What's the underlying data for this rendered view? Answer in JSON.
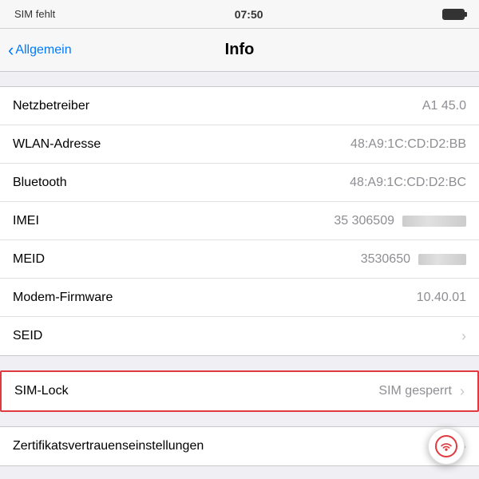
{
  "statusBar": {
    "carrier": "SIM fehlt",
    "time": "07:50"
  },
  "navBar": {
    "backLabel": "Allgemein",
    "title": "Info"
  },
  "sections": [
    {
      "id": "main-info",
      "rows": [
        {
          "label": "Netzbetreiber",
          "value": "A1 45.0",
          "hasChevron": false,
          "special": null
        },
        {
          "label": "WLAN-Adresse",
          "value": "48:A9:1C:CD:D2:BB",
          "hasChevron": false,
          "special": null
        },
        {
          "label": "Bluetooth",
          "value": "48:A9:1C:CD:D2:BC",
          "hasChevron": false,
          "special": null
        },
        {
          "label": "IMEI",
          "value": "35 306509",
          "hasChevron": false,
          "special": "imei-blur"
        },
        {
          "label": "MEID",
          "value": "3530650",
          "hasChevron": false,
          "special": "meid-blur"
        },
        {
          "label": "Modem-Firmware",
          "value": "10.40.01",
          "hasChevron": false,
          "special": null
        },
        {
          "label": "SEID",
          "value": "",
          "hasChevron": true,
          "special": null
        }
      ]
    }
  ],
  "simlockRow": {
    "label": "SIM-Lock",
    "value": "SIM gesperrt",
    "hasChevron": true
  },
  "certRow": {
    "label": "Zertifikatsvertrauenseinstellungen",
    "hasChevron": true
  },
  "floatButton": {
    "ariaLabel": "AssistiveTouch"
  }
}
